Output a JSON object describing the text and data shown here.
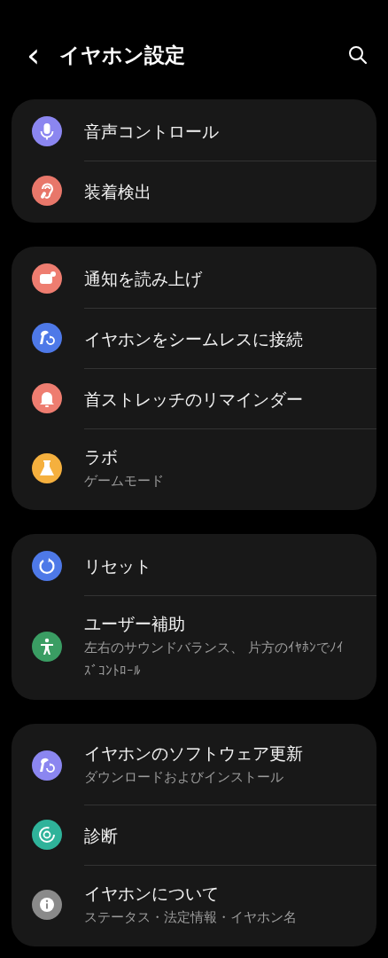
{
  "header": {
    "back": "‹",
    "title": "イヤホン設定"
  },
  "cards": [
    {
      "items": [
        {
          "title": "音声コントロール",
          "kind": "mic",
          "color": "#8b86f0"
        },
        {
          "title": "装着検出",
          "kind": "ear",
          "color": "#e8776a"
        }
      ]
    },
    {
      "items": [
        {
          "title": "通知を読み上げ",
          "kind": "notify",
          "color": "#ee7d70"
        },
        {
          "title": "イヤホンをシームレスに接続",
          "kind": "earbud-sync",
          "color": "#4e79e8"
        },
        {
          "title": "首ストレッチのリマインダー",
          "kind": "bell",
          "color": "#ee7d70"
        },
        {
          "title": "ラボ",
          "subtitle": "ゲームモード",
          "kind": "flask",
          "color": "#f5b03e"
        }
      ]
    },
    {
      "items": [
        {
          "title": "リセット",
          "kind": "reset",
          "color": "#4e79e8"
        },
        {
          "title": "ユーザー補助",
          "subtitle": "左右のサウンドバランス、 片方のｲﾔﾎﾝでﾉｲｽﾞｺﾝﾄﾛｰﾙ",
          "kind": "person",
          "color": "#3a9d63"
        }
      ]
    },
    {
      "items": [
        {
          "title": "イヤホンのソフトウェア更新",
          "subtitle": "ダウンロードおよびインストール",
          "kind": "earbud-sync",
          "color": "#8b86f0"
        },
        {
          "title": "診断",
          "kind": "diagnose",
          "color": "#2fb39a"
        },
        {
          "title": "イヤホンについて",
          "subtitle": "ステータス・法定情報・イヤホン名",
          "kind": "info",
          "color": "#8a8a8a"
        }
      ]
    }
  ]
}
